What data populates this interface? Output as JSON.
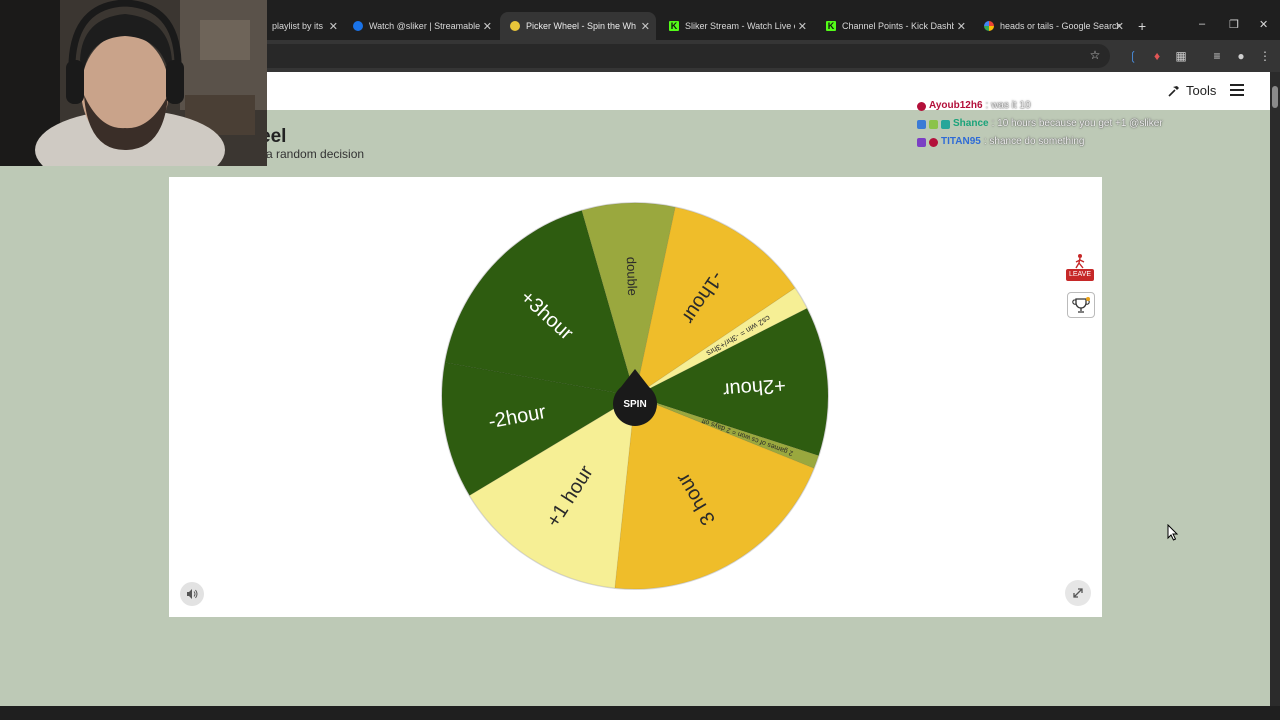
{
  "browser": {
    "tabs": [
      {
        "title": "playlist by its",
        "favicon": "music-favicon",
        "active": false
      },
      {
        "title": "Watch @sliker | Streamable",
        "favicon": "streamable-favicon",
        "active": false
      },
      {
        "title": "Picker Wheel - Spin the Wheel",
        "favicon": "picker-wheel-favicon",
        "active": true
      },
      {
        "title": "Sliker Stream - Watch Live on K",
        "favicon": "kick-favicon",
        "active": false
      },
      {
        "title": "Channel Points - Kick Dashboar",
        "favicon": "kick-favicon",
        "active": false
      },
      {
        "title": "heads or tails - Google Search",
        "favicon": "google-favicon",
        "active": false
      }
    ],
    "new_tab_label": "+",
    "close_glyph": "✕"
  },
  "header": {
    "tools_label": "Tools",
    "title": "eel",
    "subtitle": "e a random decision"
  },
  "chat": [
    {
      "user": "Ayoub12h6",
      "message": ": was it 10",
      "color": "#b3103a"
    },
    {
      "user": "Shance",
      "message": ": 10 hours because you get +1 @sliker",
      "color": "#1aa37a"
    },
    {
      "user": "TITAN95",
      "message": ": shance do something",
      "color": "#2f6bd6"
    }
  ],
  "wheel": {
    "spin_label": "SPIN",
    "leave_label": "LEAVE",
    "slices": [
      {
        "label": "-1hour",
        "color": "#efbd2a"
      },
      {
        "label": "cs2 win = -3hr/+3hrs",
        "color": "#f6ef95"
      },
      {
        "label": "+2hour",
        "color": "#2e5c10"
      },
      {
        "label": "2 games of cs won = 2 days off",
        "color": "#9aa83e"
      },
      {
        "label": "3 hour",
        "color": "#efbd2a"
      },
      {
        "label": "+1 hour",
        "color": "#f6ef95"
      },
      {
        "label": "-2hour",
        "color": "#2e5c10"
      },
      {
        "label": "+3hour",
        "color": "#2e5c10"
      },
      {
        "label": "double",
        "color": "#9aa83e"
      }
    ]
  },
  "colors": {
    "page_bg": "#bdc9b6",
    "chrome_dark": "#1f1f1f",
    "chrome_toolbar": "#353535"
  }
}
